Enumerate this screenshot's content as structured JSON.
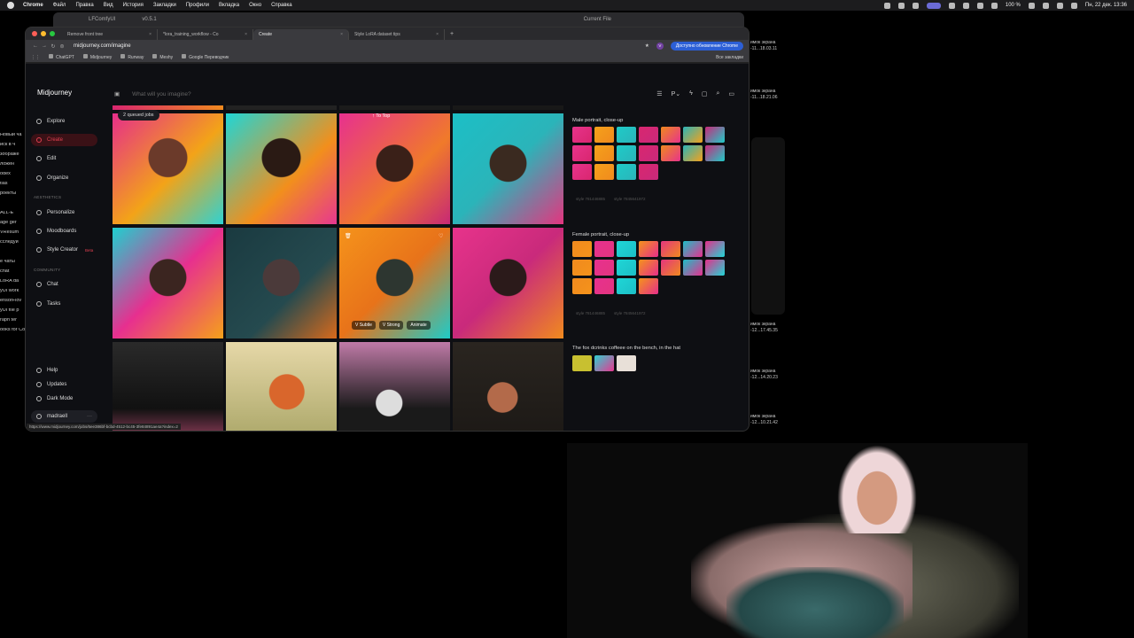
{
  "menubar": {
    "app": "Chrome",
    "items": [
      "Файл",
      "Правка",
      "Вид",
      "История",
      "Закладки",
      "Профили",
      "Вкладка",
      "Окно",
      "Справка"
    ],
    "battery": "100 %",
    "clock": "Пн, 22 дек. 13:36"
  },
  "background_window": {
    "title": "LFComfyUI",
    "version": "v0.5.1",
    "current_file": "Current File"
  },
  "left_strip": [
    "Новый ча",
    "иск в ч",
    "зображе",
    "ложен",
    "odex",
    "tlas",
    "роекты",
    "",
    "ALL-E",
    "age ger",
    "VResum",
    "сследуй",
    "",
    "е чаты",
    "chat",
    "LoRA da",
    "yUI work",
    "ensorFlov",
    "yUI file p",
    "raph ter",
    "ooks for ComfyUI"
  ],
  "right_strip": {
    "shot1": "имок экрана",
    "shot1_time": "-11...18.03.11",
    "shot2": "имок экрана",
    "shot2_time": "-11...18.21.06",
    "shot3": "имок экрана",
    "shot3_time": "-12...17.45.35",
    "shot4": "имок экрана",
    "shot4_time": "-12...14.20.23",
    "shot5": "имок экрана",
    "shot5_time": "-12...10.21.42"
  },
  "browser": {
    "tabs": [
      {
        "label": "Remove front tree"
      },
      {
        "label": "*lora_training_workflow - Co"
      },
      {
        "label": "Create"
      },
      {
        "label": "Style LoRA dataset tips"
      }
    ],
    "url": "midjourney.com/imagine",
    "update_label": "Доступно обновление Chrome",
    "profile_initial": "V",
    "bookmarks": [
      "ChatGPT",
      "Midjourney",
      "Runway",
      "Meshy",
      "Google Переводчик"
    ],
    "all_bookmarks": "Все закладки",
    "status_url": "https://www.midjourney.com/jobs/6ee386bf-bcbd-4512-bc45-3fe84891ae4a?index=2"
  },
  "midjourney": {
    "logo": "Midjourney",
    "nav": {
      "explore": "Explore",
      "create": "Create",
      "edit": "Edit",
      "organize": "Organize",
      "aesthetics_heading": "AESTHETICS",
      "personalize": "Personalize",
      "moodboards": "Moodboards",
      "style_creator": "Style Creator",
      "beta": "Beta",
      "community_heading": "COMMUNITY",
      "chat": "Chat",
      "tasks": "Tasks",
      "help": "Help",
      "updates": "Updates",
      "dark_mode": "Dark Mode",
      "user": "madraell"
    },
    "search_placeholder": "What will you imagine?",
    "queued": "2 queued jobs",
    "to_top": "To Top",
    "tile_actions": [
      "V Subtle",
      "V Strong",
      "Animate"
    ],
    "jobs": [
      {
        "prompt": "Male portrait, close-up",
        "style_tags": [
          "style 781446885",
          "style 7845641972"
        ]
      },
      {
        "prompt": "Female portrait, close-up",
        "style_tags": [
          "style 781446885",
          "style 7845641972"
        ]
      },
      {
        "prompt": "The fox dcrinks coffeee on the bench, in the hat"
      }
    ]
  },
  "colors": {
    "accent": "#e04050",
    "mj_bg": "#0e0f13",
    "update_button": "#2c5fd6"
  }
}
